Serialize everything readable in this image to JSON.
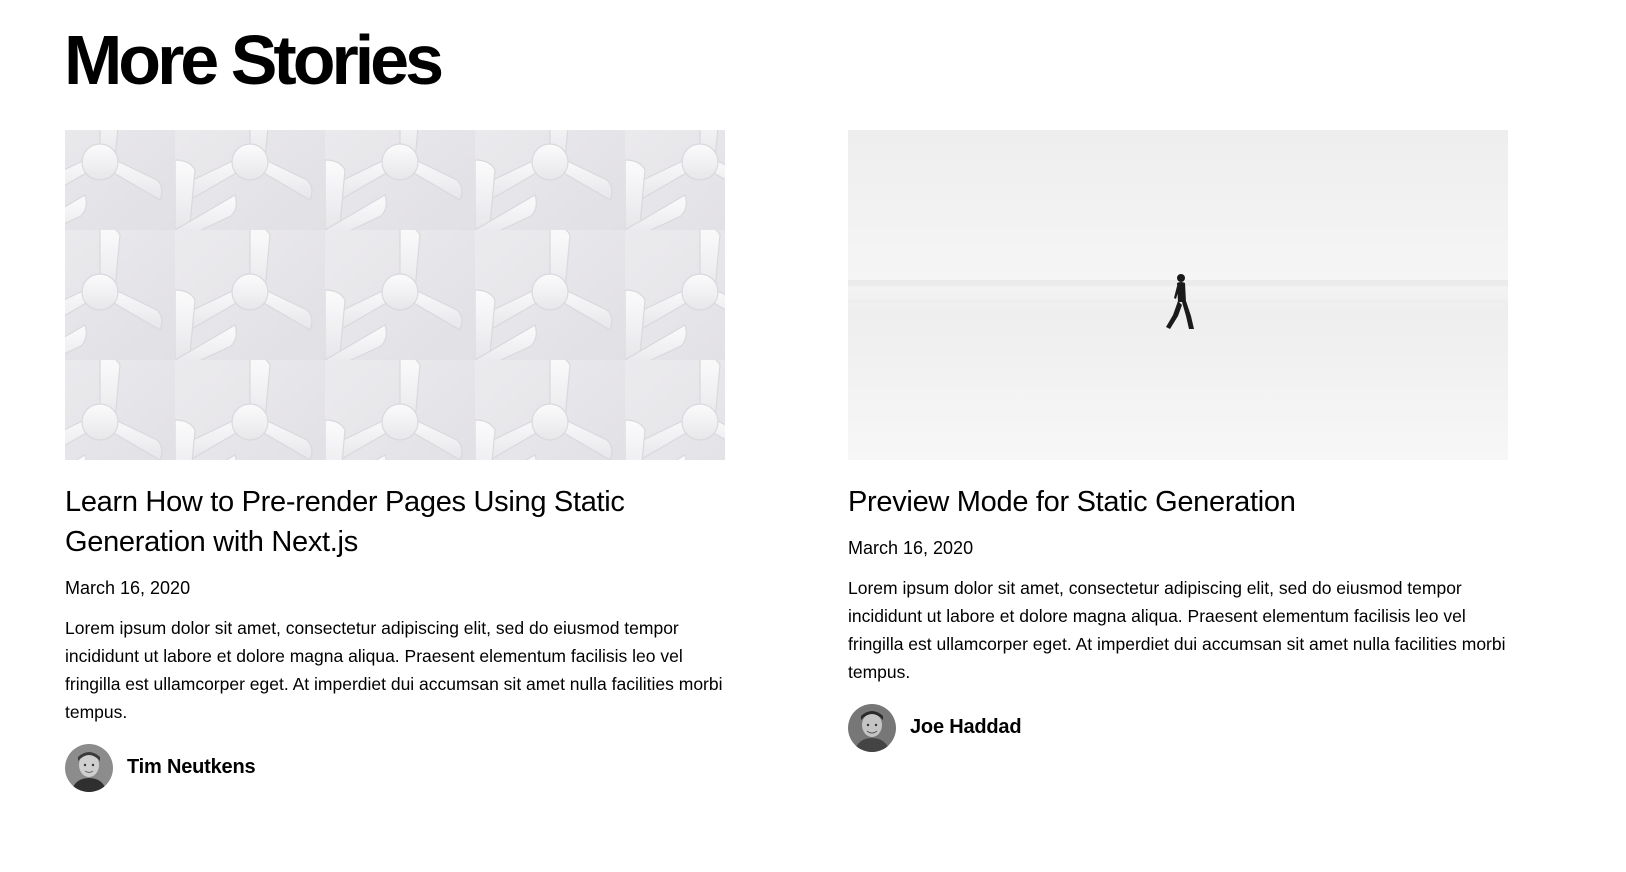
{
  "section": {
    "title": "More Stories"
  },
  "posts": [
    {
      "cover_icon": "weave-pattern-image",
      "title": "Learn How to Pre-render Pages Using Static Generation with Next.js",
      "date": "March 16, 2020",
      "excerpt": "Lorem ipsum dolor sit amet, consectetur adipiscing elit, sed do eiusmod tempor incididunt ut labore et dolore magna aliqua. Praesent elementum facilisis leo vel fringilla est ullamcorper eget. At imperdiet dui accumsan sit amet nulla facilities morbi tempus.",
      "author": {
        "name": "Tim Neutkens",
        "avatar_icon": "author-avatar"
      }
    },
    {
      "cover_icon": "person-walking-in-snow-image",
      "title": "Preview Mode for Static Generation",
      "date": "March 16, 2020",
      "excerpt": "Lorem ipsum dolor sit amet, consectetur adipiscing elit, sed do eiusmod tempor incididunt ut labore et dolore magna aliqua. Praesent elementum facilisis leo vel fringilla est ullamcorper eget. At imperdiet dui accumsan sit amet nulla facilities morbi tempus.",
      "author": {
        "name": "Joe Haddad",
        "avatar_icon": "author-avatar"
      }
    }
  ],
  "colors": {
    "text": "#000000",
    "background": "#ffffff",
    "cover_pattern": "#e6e5e8",
    "snow": "#f3f3f3"
  }
}
